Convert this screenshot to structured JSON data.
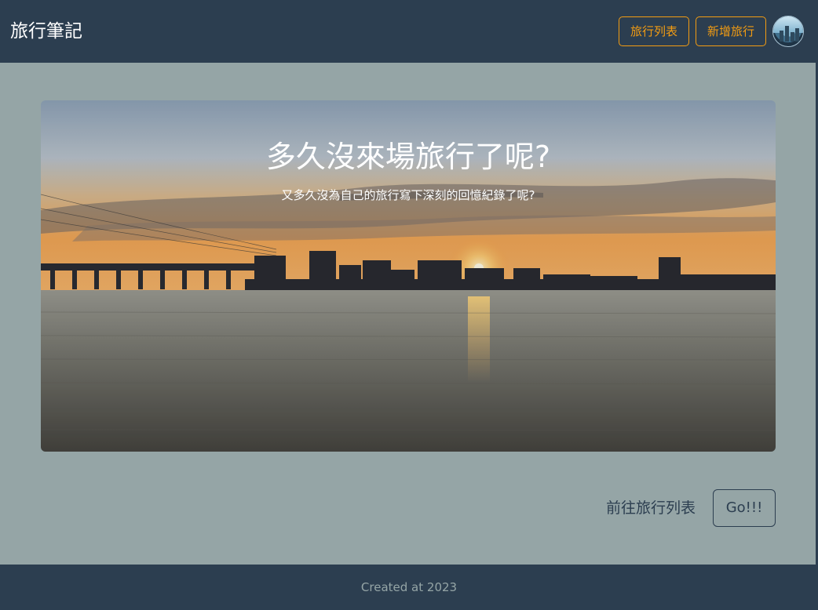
{
  "navbar": {
    "brand": "旅行筆記",
    "list_button": "旅行列表",
    "new_button": "新增旅行",
    "avatar_icon": "user-avatar"
  },
  "hero": {
    "title": "多久沒來場旅行了呢?",
    "subtitle": "又多久沒為自己的旅行寫下深刻的回憶紀錄了呢?",
    "image_subject": "sunset-over-river-cityscape"
  },
  "cta": {
    "label": "前往旅行列表",
    "button": "Go!!!"
  },
  "footer": {
    "text": "Created at 2023"
  },
  "colors": {
    "navbar_bg": "#2c3e50",
    "page_bg": "#95a5a6",
    "accent": "#f39c12"
  }
}
